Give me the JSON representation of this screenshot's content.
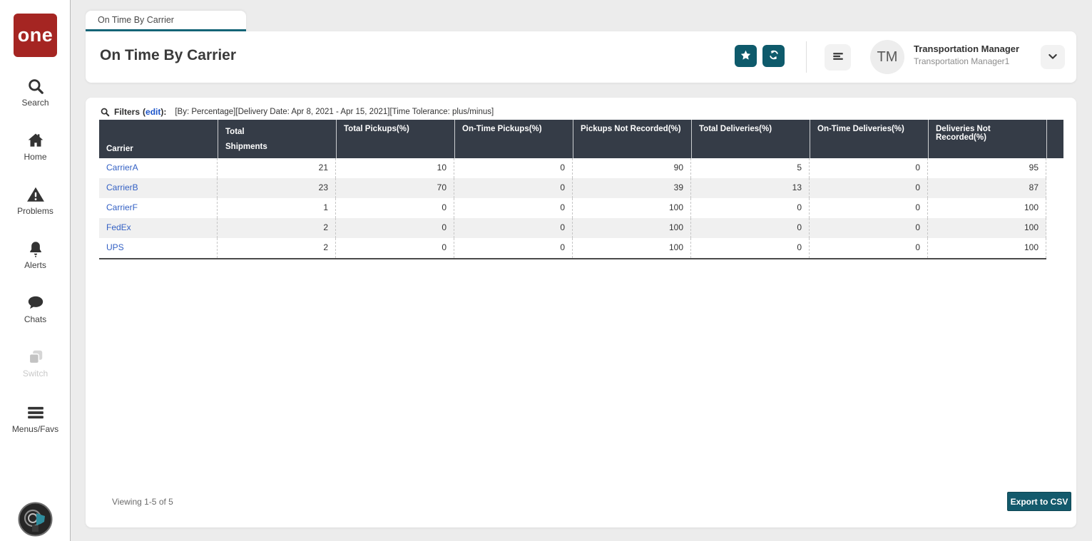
{
  "brand": {
    "logo_text": "one"
  },
  "sidebar": {
    "items": [
      {
        "label": "Search"
      },
      {
        "label": "Home"
      },
      {
        "label": "Problems"
      },
      {
        "label": "Alerts"
      },
      {
        "label": "Chats"
      },
      {
        "label": "Switch"
      },
      {
        "label": "Menus/Favs"
      }
    ]
  },
  "tab": {
    "label": "On Time By Carrier"
  },
  "header": {
    "title": "On Time By Carrier",
    "user": {
      "initials": "TM",
      "role": "Transportation Manager",
      "username": "Transportation Manager1"
    }
  },
  "filters": {
    "label": "Filters",
    "prefix": "(",
    "edit": "edit",
    "suffix": "):",
    "summary": "[By: Percentage][Delivery Date: Apr 8, 2021 - Apr 15, 2021][Time Tolerance: plus/minus]"
  },
  "table": {
    "columns": [
      "Carrier",
      "Total Shipments",
      "Total Pickups(%)",
      "On-Time Pickups(%)",
      "Pickups Not Recorded(%)",
      "Total Deliveries(%)",
      "On-Time Deliveries(%)",
      "Deliveries Not Recorded(%)"
    ],
    "rows": [
      {
        "carrier": "CarrierA",
        "values": [
          21,
          10,
          0,
          90,
          5,
          0,
          95
        ]
      },
      {
        "carrier": "CarrierB",
        "values": [
          23,
          70,
          0,
          39,
          13,
          0,
          87
        ]
      },
      {
        "carrier": "CarrierF",
        "values": [
          1,
          0,
          0,
          100,
          0,
          0,
          100
        ]
      },
      {
        "carrier": "FedEx",
        "values": [
          2,
          0,
          0,
          100,
          0,
          0,
          100
        ]
      },
      {
        "carrier": "UPS",
        "values": [
          2,
          0,
          0,
          100,
          0,
          0,
          100
        ]
      }
    ]
  },
  "footer": {
    "viewing": "Viewing 1-5 of 5",
    "export_label": "Export to CSV"
  },
  "colors": {
    "brand_red": "#A52522",
    "button_teal": "#0E5A6B",
    "tab_accent": "#156577",
    "table_header_bg": "#353C47",
    "link_blue": "#3360C4",
    "row_alt": "#F0F0F0"
  }
}
